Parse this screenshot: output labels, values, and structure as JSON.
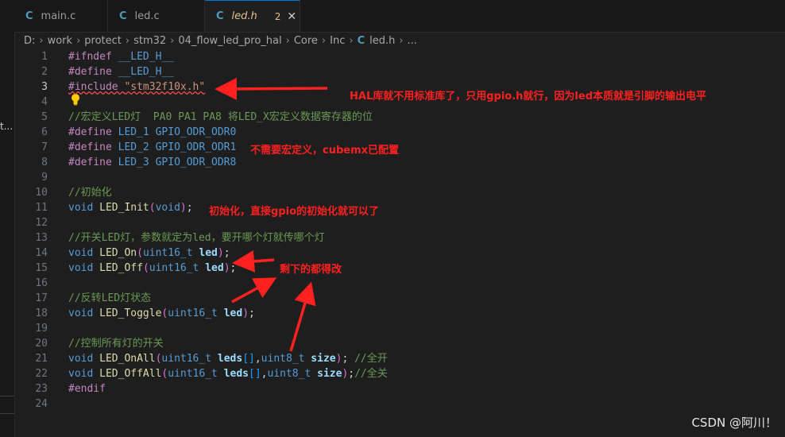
{
  "sidebar": {
    "stub_text": "t..."
  },
  "tabs": [
    {
      "label": "main.c",
      "icon": "C"
    },
    {
      "label": "led.c",
      "icon": "C"
    },
    {
      "label": "led.h",
      "icon": "C",
      "badge": "2",
      "close": "✕"
    }
  ],
  "breadcrumb": {
    "segments": [
      "D:",
      "work",
      "protect",
      "stm32",
      "04_flow_led_pro_hal",
      "Core",
      "Inc"
    ],
    "file_icon": "C",
    "file": "led.h",
    "trail": "..."
  },
  "lines": [
    {
      "n": "1",
      "tokens": [
        {
          "t": "#ifndef ",
          "c": "pp"
        },
        {
          "t": "__LED_H__",
          "c": "mac"
        }
      ]
    },
    {
      "n": "2",
      "tokens": [
        {
          "t": "#define ",
          "c": "pp"
        },
        {
          "t": "__LED_H__",
          "c": "mac"
        }
      ]
    },
    {
      "n": "3",
      "tokens": [
        {
          "t": "#include ",
          "c": "pp squig"
        },
        {
          "t": "\"stm32f10x.h\"",
          "c": "str squig"
        }
      ]
    },
    {
      "n": "4",
      "tokens": []
    },
    {
      "n": "5",
      "tokens": [
        {
          "t": "//宏定义LED灯  PA0 PA1 PA8 将LED_X宏定义数据寄存器的位",
          "c": "cm"
        }
      ]
    },
    {
      "n": "6",
      "tokens": [
        {
          "t": "#define ",
          "c": "pp"
        },
        {
          "t": "LED_1 ",
          "c": "mac"
        },
        {
          "t": "GPIO_ODR_ODR0",
          "c": "mac"
        }
      ]
    },
    {
      "n": "7",
      "tokens": [
        {
          "t": "#define ",
          "c": "pp"
        },
        {
          "t": "LED_2 ",
          "c": "mac"
        },
        {
          "t": "GPIO_ODR_ODR1",
          "c": "mac"
        }
      ]
    },
    {
      "n": "8",
      "tokens": [
        {
          "t": "#define ",
          "c": "pp"
        },
        {
          "t": "LED_3 ",
          "c": "mac"
        },
        {
          "t": "GPIO_ODR_ODR8",
          "c": "mac"
        }
      ]
    },
    {
      "n": "9",
      "tokens": []
    },
    {
      "n": "10",
      "tokens": [
        {
          "t": "//初始化",
          "c": "cm"
        }
      ]
    },
    {
      "n": "11",
      "tokens": [
        {
          "t": "void ",
          "c": "kw"
        },
        {
          "t": "LED_Init",
          "c": "fn"
        },
        {
          "t": "(",
          "c": "paren"
        },
        {
          "t": "void",
          "c": "kw"
        },
        {
          "t": ")",
          "c": "paren"
        },
        {
          "t": ";",
          "c": "pun"
        }
      ]
    },
    {
      "n": "12",
      "tokens": []
    },
    {
      "n": "13",
      "tokens": [
        {
          "t": "//开关LED灯，参数就定为led，要开哪个灯就传哪个灯",
          "c": "cm"
        }
      ]
    },
    {
      "n": "14",
      "tokens": [
        {
          "t": "void ",
          "c": "kw"
        },
        {
          "t": "LED_On",
          "c": "fn"
        },
        {
          "t": "(",
          "c": "paren"
        },
        {
          "t": "uint16_t ",
          "c": "ty"
        },
        {
          "t": "led",
          "c": "par"
        },
        {
          "t": ")",
          "c": "paren"
        },
        {
          "t": ";",
          "c": "pun"
        }
      ]
    },
    {
      "n": "15",
      "tokens": [
        {
          "t": "void ",
          "c": "kw"
        },
        {
          "t": "LED_Off",
          "c": "fn"
        },
        {
          "t": "(",
          "c": "paren"
        },
        {
          "t": "uint16_t ",
          "c": "ty"
        },
        {
          "t": "led",
          "c": "par"
        },
        {
          "t": ")",
          "c": "paren"
        },
        {
          "t": ";",
          "c": "pun"
        }
      ]
    },
    {
      "n": "16",
      "tokens": []
    },
    {
      "n": "17",
      "tokens": [
        {
          "t": "//反转LED灯状态",
          "c": "cm"
        }
      ]
    },
    {
      "n": "18",
      "tokens": [
        {
          "t": "void ",
          "c": "kw"
        },
        {
          "t": "LED_Toggle",
          "c": "fn"
        },
        {
          "t": "(",
          "c": "paren"
        },
        {
          "t": "uint16_t ",
          "c": "ty"
        },
        {
          "t": "led",
          "c": "par"
        },
        {
          "t": ")",
          "c": "paren"
        },
        {
          "t": ";",
          "c": "pun"
        }
      ]
    },
    {
      "n": "19",
      "tokens": []
    },
    {
      "n": "20",
      "tokens": [
        {
          "t": "//控制所有灯的开关",
          "c": "cm"
        }
      ]
    },
    {
      "n": "21",
      "tokens": [
        {
          "t": "void ",
          "c": "kw"
        },
        {
          "t": "LED_OnAll",
          "c": "fn"
        },
        {
          "t": "(",
          "c": "paren"
        },
        {
          "t": "uint16_t ",
          "c": "ty"
        },
        {
          "t": "leds",
          "c": "par"
        },
        {
          "t": "[]",
          "c": "brk"
        },
        {
          "t": ",",
          "c": "pun"
        },
        {
          "t": "uint8_t ",
          "c": "ty"
        },
        {
          "t": "size",
          "c": "par"
        },
        {
          "t": ")",
          "c": "paren"
        },
        {
          "t": "; ",
          "c": "pun"
        },
        {
          "t": "//全开",
          "c": "cm"
        }
      ]
    },
    {
      "n": "22",
      "tokens": [
        {
          "t": "void ",
          "c": "kw"
        },
        {
          "t": "LED_OffAll",
          "c": "fn"
        },
        {
          "t": "(",
          "c": "paren"
        },
        {
          "t": "uint16_t ",
          "c": "ty"
        },
        {
          "t": "leds",
          "c": "par"
        },
        {
          "t": "[]",
          "c": "brk"
        },
        {
          "t": ",",
          "c": "pun"
        },
        {
          "t": "uint8_t ",
          "c": "ty"
        },
        {
          "t": "size",
          "c": "par"
        },
        {
          "t": ")",
          "c": "paren"
        },
        {
          "t": ";",
          "c": "pun"
        },
        {
          "t": "//全关",
          "c": "cm"
        }
      ]
    },
    {
      "n": "23",
      "tokens": [
        {
          "t": "#endif",
          "c": "pp"
        }
      ]
    },
    {
      "n": "24",
      "tokens": []
    }
  ],
  "current_line": "3",
  "annotations": {
    "hal": "HAL库就不用标准库了，只用gpio.h就行，因为led本质就是引脚的输出电平",
    "no_macro": "不需要宏定义，cubemx已配置",
    "init": "初始化，直接gpio的初始化就可以了",
    "rest": "剩下的都得改"
  },
  "annotation_color": "#ff2020",
  "watermark": "CSDN @阿川！"
}
